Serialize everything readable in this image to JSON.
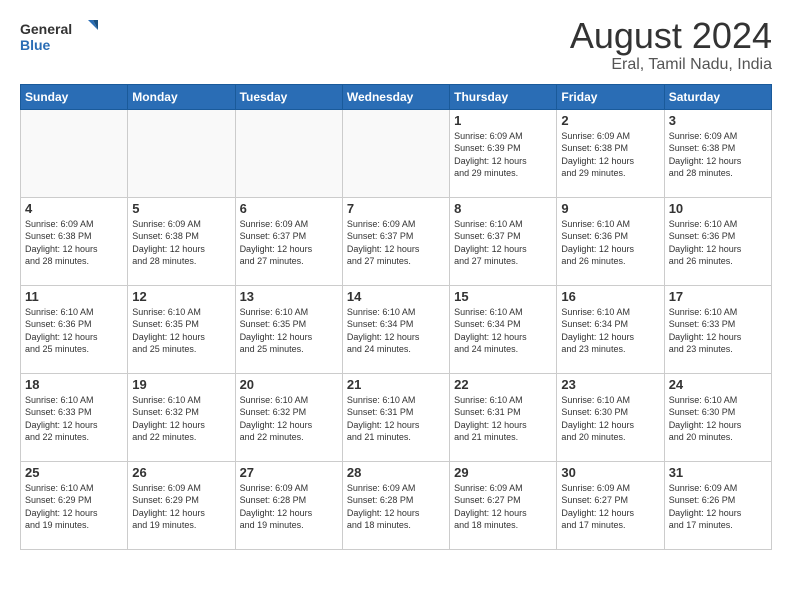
{
  "header": {
    "logo_line1": "General",
    "logo_line2": "Blue",
    "title": "August 2024",
    "subtitle": "Eral, Tamil Nadu, India"
  },
  "weekdays": [
    "Sunday",
    "Monday",
    "Tuesday",
    "Wednesday",
    "Thursday",
    "Friday",
    "Saturday"
  ],
  "weeks": [
    [
      {
        "day": "",
        "info": ""
      },
      {
        "day": "",
        "info": ""
      },
      {
        "day": "",
        "info": ""
      },
      {
        "day": "",
        "info": ""
      },
      {
        "day": "1",
        "info": "Sunrise: 6:09 AM\nSunset: 6:39 PM\nDaylight: 12 hours\nand 29 minutes."
      },
      {
        "day": "2",
        "info": "Sunrise: 6:09 AM\nSunset: 6:38 PM\nDaylight: 12 hours\nand 29 minutes."
      },
      {
        "day": "3",
        "info": "Sunrise: 6:09 AM\nSunset: 6:38 PM\nDaylight: 12 hours\nand 28 minutes."
      }
    ],
    [
      {
        "day": "4",
        "info": "Sunrise: 6:09 AM\nSunset: 6:38 PM\nDaylight: 12 hours\nand 28 minutes."
      },
      {
        "day": "5",
        "info": "Sunrise: 6:09 AM\nSunset: 6:38 PM\nDaylight: 12 hours\nand 28 minutes."
      },
      {
        "day": "6",
        "info": "Sunrise: 6:09 AM\nSunset: 6:37 PM\nDaylight: 12 hours\nand 27 minutes."
      },
      {
        "day": "7",
        "info": "Sunrise: 6:09 AM\nSunset: 6:37 PM\nDaylight: 12 hours\nand 27 minutes."
      },
      {
        "day": "8",
        "info": "Sunrise: 6:10 AM\nSunset: 6:37 PM\nDaylight: 12 hours\nand 27 minutes."
      },
      {
        "day": "9",
        "info": "Sunrise: 6:10 AM\nSunset: 6:36 PM\nDaylight: 12 hours\nand 26 minutes."
      },
      {
        "day": "10",
        "info": "Sunrise: 6:10 AM\nSunset: 6:36 PM\nDaylight: 12 hours\nand 26 minutes."
      }
    ],
    [
      {
        "day": "11",
        "info": "Sunrise: 6:10 AM\nSunset: 6:36 PM\nDaylight: 12 hours\nand 25 minutes."
      },
      {
        "day": "12",
        "info": "Sunrise: 6:10 AM\nSunset: 6:35 PM\nDaylight: 12 hours\nand 25 minutes."
      },
      {
        "day": "13",
        "info": "Sunrise: 6:10 AM\nSunset: 6:35 PM\nDaylight: 12 hours\nand 25 minutes."
      },
      {
        "day": "14",
        "info": "Sunrise: 6:10 AM\nSunset: 6:34 PM\nDaylight: 12 hours\nand 24 minutes."
      },
      {
        "day": "15",
        "info": "Sunrise: 6:10 AM\nSunset: 6:34 PM\nDaylight: 12 hours\nand 24 minutes."
      },
      {
        "day": "16",
        "info": "Sunrise: 6:10 AM\nSunset: 6:34 PM\nDaylight: 12 hours\nand 23 minutes."
      },
      {
        "day": "17",
        "info": "Sunrise: 6:10 AM\nSunset: 6:33 PM\nDaylight: 12 hours\nand 23 minutes."
      }
    ],
    [
      {
        "day": "18",
        "info": "Sunrise: 6:10 AM\nSunset: 6:33 PM\nDaylight: 12 hours\nand 22 minutes."
      },
      {
        "day": "19",
        "info": "Sunrise: 6:10 AM\nSunset: 6:32 PM\nDaylight: 12 hours\nand 22 minutes."
      },
      {
        "day": "20",
        "info": "Sunrise: 6:10 AM\nSunset: 6:32 PM\nDaylight: 12 hours\nand 22 minutes."
      },
      {
        "day": "21",
        "info": "Sunrise: 6:10 AM\nSunset: 6:31 PM\nDaylight: 12 hours\nand 21 minutes."
      },
      {
        "day": "22",
        "info": "Sunrise: 6:10 AM\nSunset: 6:31 PM\nDaylight: 12 hours\nand 21 minutes."
      },
      {
        "day": "23",
        "info": "Sunrise: 6:10 AM\nSunset: 6:30 PM\nDaylight: 12 hours\nand 20 minutes."
      },
      {
        "day": "24",
        "info": "Sunrise: 6:10 AM\nSunset: 6:30 PM\nDaylight: 12 hours\nand 20 minutes."
      }
    ],
    [
      {
        "day": "25",
        "info": "Sunrise: 6:10 AM\nSunset: 6:29 PM\nDaylight: 12 hours\nand 19 minutes."
      },
      {
        "day": "26",
        "info": "Sunrise: 6:09 AM\nSunset: 6:29 PM\nDaylight: 12 hours\nand 19 minutes."
      },
      {
        "day": "27",
        "info": "Sunrise: 6:09 AM\nSunset: 6:28 PM\nDaylight: 12 hours\nand 19 minutes."
      },
      {
        "day": "28",
        "info": "Sunrise: 6:09 AM\nSunset: 6:28 PM\nDaylight: 12 hours\nand 18 minutes."
      },
      {
        "day": "29",
        "info": "Sunrise: 6:09 AM\nSunset: 6:27 PM\nDaylight: 12 hours\nand 18 minutes."
      },
      {
        "day": "30",
        "info": "Sunrise: 6:09 AM\nSunset: 6:27 PM\nDaylight: 12 hours\nand 17 minutes."
      },
      {
        "day": "31",
        "info": "Sunrise: 6:09 AM\nSunset: 6:26 PM\nDaylight: 12 hours\nand 17 minutes."
      }
    ]
  ]
}
